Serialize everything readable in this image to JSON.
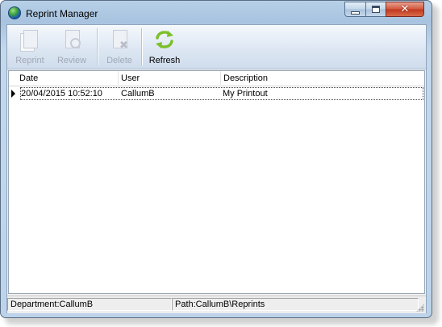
{
  "window": {
    "title": "Reprint Manager",
    "controls": {
      "minimize": "minimize",
      "maximize": "maximize",
      "close": "✕"
    }
  },
  "toolbar": {
    "reprint_label": "Reprint",
    "review_label": "Review",
    "delete_label": "Delete",
    "refresh_label": "Refresh"
  },
  "list": {
    "columns": [
      "Date",
      "User",
      "Description"
    ],
    "rows": [
      {
        "date": "20/04/2015 10:52:10",
        "user": "CallumB",
        "description": "My Printout"
      }
    ]
  },
  "status": {
    "department": "Department:CallumB",
    "path": "Path:CallumB\\Reprints"
  },
  "colors": {
    "title_bar": "#a8c3df",
    "close_button": "#c0381f",
    "refresh_icon": "#7dbf2a"
  }
}
